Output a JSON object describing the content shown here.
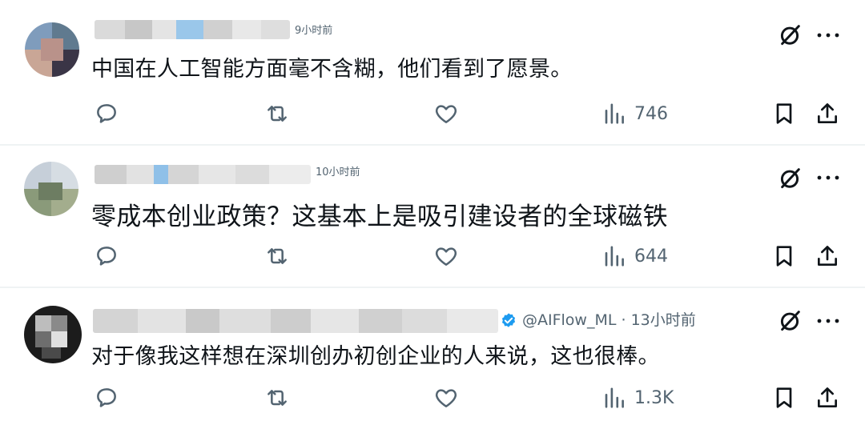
{
  "posts": [
    {
      "time": "9小时前",
      "content": "中国在人工智能方面毫不含糊，他们看到了愿景。",
      "views": "746"
    },
    {
      "time": "10小时前",
      "content": "零成本创业政策？这基本上是吸引建设者的全球磁铁",
      "views": "644"
    },
    {
      "handle_time": "@AIFlow_ML · 13小时前",
      "content": "对于像我这样想在深圳创办初创企业的人来说，这也很棒。",
      "views": "1.3K"
    }
  ],
  "icons": {
    "reply": "reply-icon",
    "repost": "repost-icon",
    "like": "heart-icon",
    "views": "views-chart-icon",
    "bookmark": "bookmark-icon",
    "share": "share-icon",
    "grok": "grok-icon",
    "more": "more-icon",
    "verified": "verified-badge-icon"
  },
  "colors": {
    "text": "#0f1419",
    "muted": "#536471",
    "verified": "#1d9bf0",
    "divider": "#eff3f4"
  }
}
